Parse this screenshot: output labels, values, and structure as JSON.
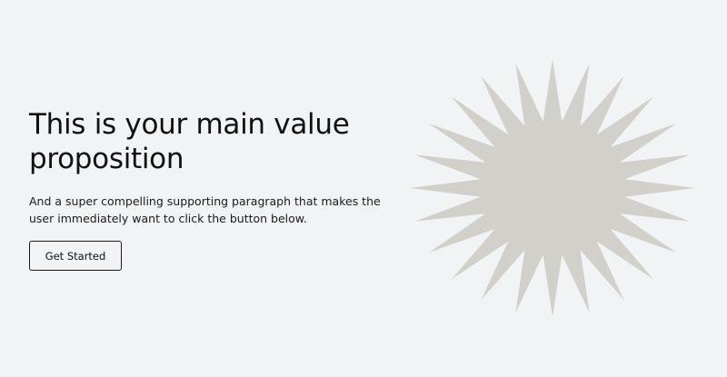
{
  "hero": {
    "headline": "This is your main value proposition",
    "subtext": "And a super compelling supporting paragraph that makes the user immediately want to click the button below.",
    "cta_label": "Get Started"
  },
  "graphic": {
    "icon": "starburst-illustration",
    "color": "#d1d0cb",
    "points": 24
  },
  "colors": {
    "background": "#f2f3f5",
    "text": "#111111"
  }
}
